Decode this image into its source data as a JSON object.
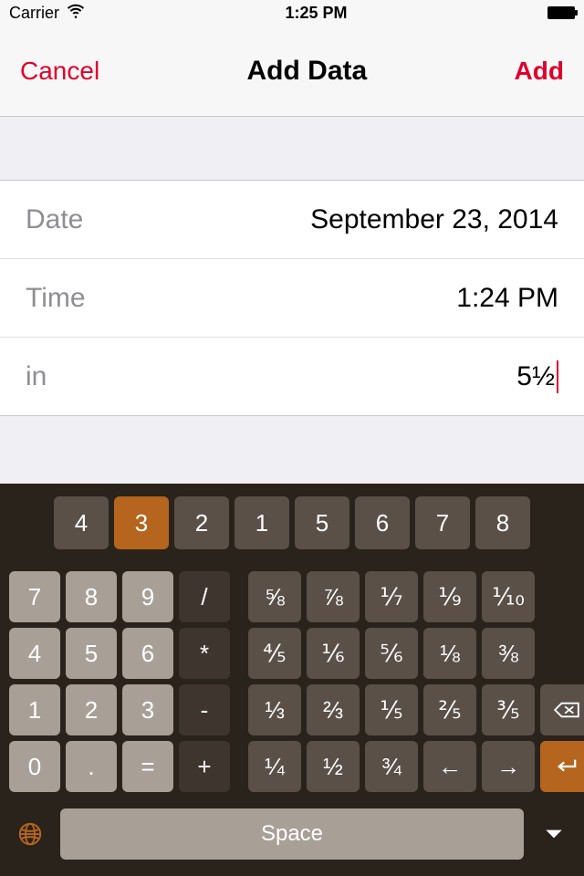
{
  "status": {
    "carrier": "Carrier",
    "time": "1:25 PM"
  },
  "nav": {
    "cancel": "Cancel",
    "title": "Add Data",
    "add": "Add"
  },
  "form": {
    "date_label": "Date",
    "date_value": "September 23, 2014",
    "time_label": "Time",
    "time_value": "1:24 PM",
    "unit_label": "in",
    "unit_value": "5½"
  },
  "keyboard": {
    "top_row": [
      "4",
      "3",
      "2",
      "1",
      "5",
      "6",
      "7",
      "8"
    ],
    "top_active_index": 1,
    "numpad": [
      [
        "7",
        "8",
        "9",
        "/"
      ],
      [
        "4",
        "5",
        "6",
        "*"
      ],
      [
        "1",
        "2",
        "3",
        "-"
      ],
      [
        "0",
        ".",
        "=",
        "+"
      ]
    ],
    "fractions": [
      [
        "⅝",
        "⅞",
        "⅐",
        "⅑",
        "⅒",
        ""
      ],
      [
        "⅘",
        "⅙",
        "⅚",
        "⅛",
        "⅜",
        ""
      ],
      [
        "⅓",
        "⅔",
        "⅕",
        "⅖",
        "⅗",
        "del"
      ],
      [
        "¼",
        "½",
        "¾",
        "←",
        "→",
        "ret"
      ]
    ],
    "space": "Space"
  }
}
